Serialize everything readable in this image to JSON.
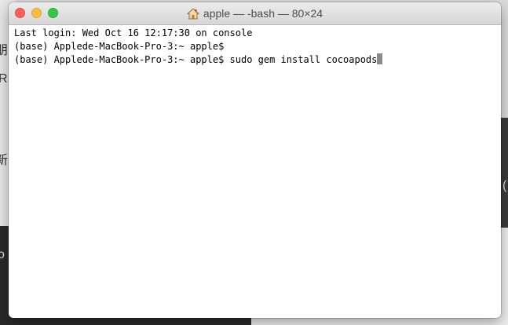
{
  "window": {
    "title": "apple — -bash — 80×24",
    "title_icon": "home-icon"
  },
  "terminal": {
    "lines": [
      "Last login: Wed Oct 16 12:17:30 on console",
      "(base) Applede-MacBook-Pro-3:~ apple$",
      "(base) Applede-MacBook-Pro-3:~ apple$ sudo gem install cocoapods"
    ]
  },
  "background": {
    "fragments": [
      "朋",
      "R",
      "新",
      "o",
      "("
    ]
  },
  "colors": {
    "close": "#fc605c",
    "minimize": "#fdbc40",
    "zoom": "#34c84a",
    "cursor": "#8a8a8a"
  }
}
